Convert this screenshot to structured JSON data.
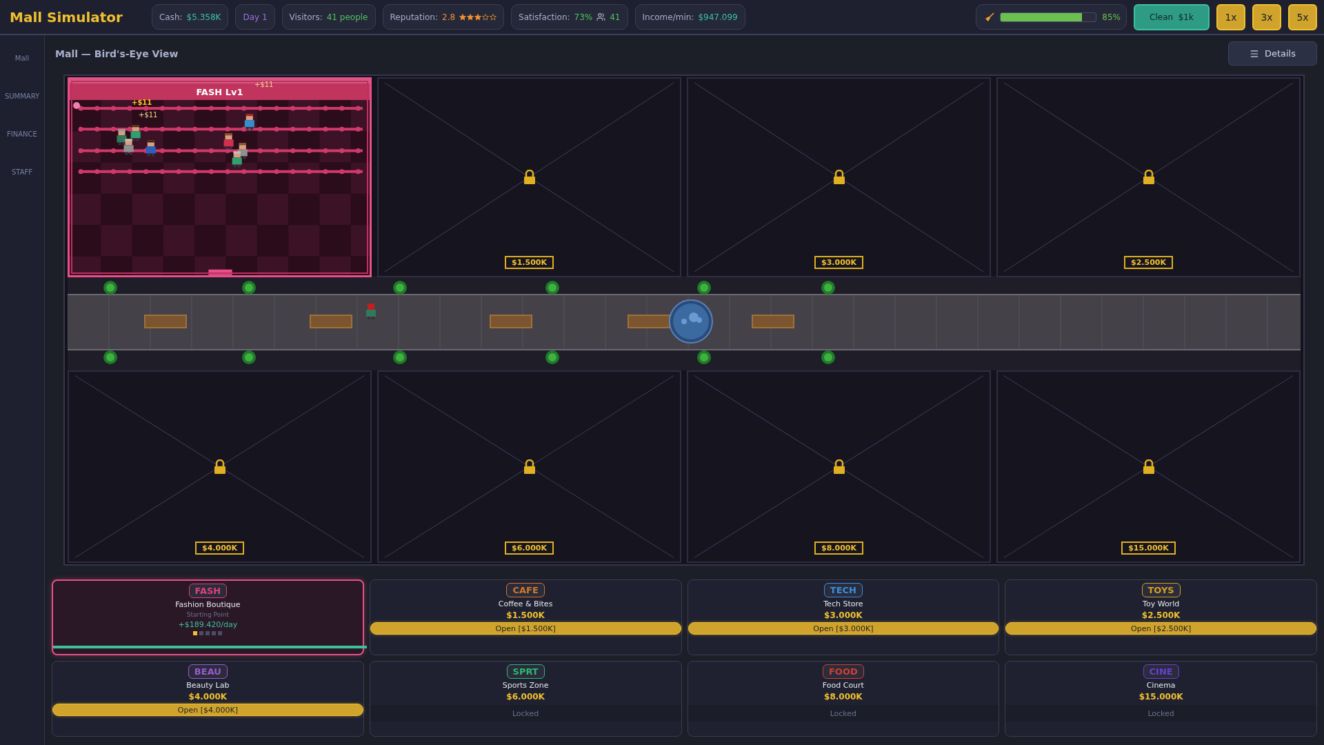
{
  "app": {
    "title": "Mall Simulator"
  },
  "stats": [
    {
      "kind": "cash",
      "label": "Cash:",
      "value": "$5.358K"
    },
    {
      "kind": "day",
      "value": "Day 1"
    },
    {
      "kind": "visitors",
      "label": "Visitors:",
      "value": "41 people"
    },
    {
      "kind": "reputation",
      "label": "Reputation:",
      "value": "2.8",
      "stars": 3
    },
    {
      "kind": "satisfaction",
      "label": "Satisfaction:",
      "value": "73%",
      "extra": "41"
    },
    {
      "kind": "income",
      "label": "Income/min:",
      "value": "$947.099"
    }
  ],
  "cleanliness": {
    "level": 0.85,
    "reading": "85%"
  },
  "clean_button": {
    "label": "Clean  $1k"
  },
  "speed_buttons": [
    {
      "label": "1x"
    },
    {
      "label": "3x"
    },
    {
      "label": "5x"
    }
  ],
  "sidebar": {
    "items": [
      {
        "label": "Mall"
      },
      {
        "label": "SUMMARY"
      },
      {
        "label": "FINANCE"
      },
      {
        "label": "STAFF"
      }
    ]
  },
  "view": {
    "title": "Mall — Bird's-Eye View",
    "details_button": "Details"
  },
  "mall": {
    "top_plots": [
      {
        "kind": "store",
        "label": "FASH Lv1",
        "floaters": [
          {
            "text": "+$11",
            "faded": true
          },
          {
            "text": "+$11",
            "faded": false
          },
          {
            "text": "+$11",
            "faded": true
          }
        ]
      },
      {
        "kind": "locked",
        "price": "$1.500K"
      },
      {
        "kind": "locked",
        "price": "$3.000K"
      },
      {
        "kind": "locked",
        "price": "$2.500K"
      }
    ],
    "bottom_plots": [
      {
        "kind": "locked",
        "price": "$4.000K"
      },
      {
        "kind": "locked",
        "price": "$6.000K"
      },
      {
        "kind": "locked",
        "price": "$8.000K"
      },
      {
        "kind": "locked",
        "price": "$15.000K"
      }
    ]
  },
  "cards": [
    {
      "code": "FASH",
      "name": "Fashion Boutique",
      "color": "#e0407a",
      "kind": "owned",
      "selected": true,
      "subtitle": "Starting Point",
      "income": "+$189.420/day",
      "stars": 1
    },
    {
      "code": "CAFE",
      "name": "Coffee & Bites",
      "color": "#d2782a",
      "kind": "available",
      "selected": false,
      "price": "$1.500K",
      "button": "Open [$1.500K]"
    },
    {
      "code": "TECH",
      "name": "Tech Store",
      "color": "#3a8ee0",
      "kind": "available",
      "selected": false,
      "price": "$3.000K",
      "button": "Open [$3.000K]"
    },
    {
      "code": "TOYS",
      "name": "Toy World",
      "color": "#d4a020",
      "kind": "available",
      "selected": false,
      "price": "$2.500K",
      "button": "Open [$2.500K]"
    },
    {
      "code": "BEAU",
      "name": "Beauty Lab",
      "color": "#9b59d0",
      "kind": "available",
      "selected": false,
      "price": "$4.000K",
      "button": "Open [$4.000K]"
    },
    {
      "code": "SPRT",
      "name": "Sports Zone",
      "color": "#2eb872",
      "kind": "locked",
      "selected": false,
      "price": "$6.000K",
      "status": "Locked"
    },
    {
      "code": "FOOD",
      "name": "Food Court",
      "color": "#d04030",
      "kind": "locked",
      "selected": false,
      "price": "$8.000K",
      "status": "Locked"
    },
    {
      "code": "CINE",
      "name": "Cinema",
      "color": "#6a3fd0",
      "kind": "locked",
      "selected": false,
      "price": "$15.000K",
      "status": "Locked"
    }
  ]
}
